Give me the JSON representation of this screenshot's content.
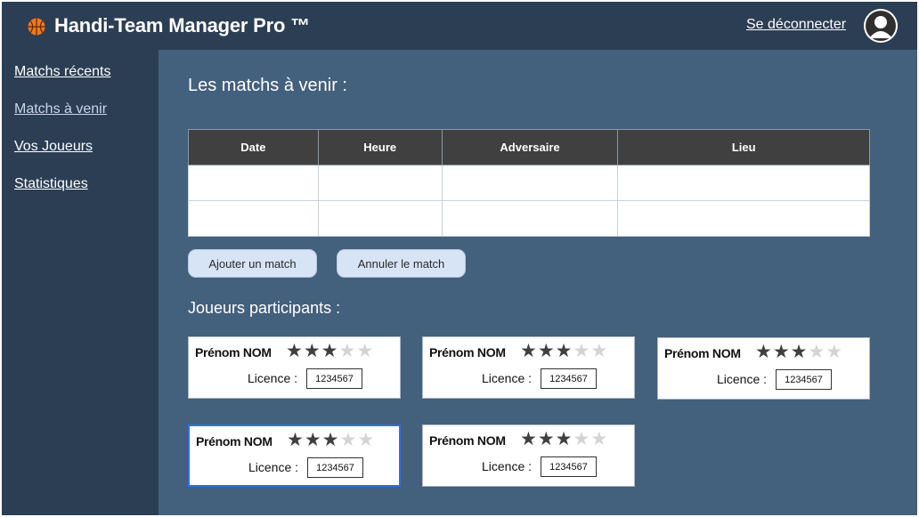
{
  "header": {
    "title": "Handi-Team Manager Pro ™",
    "logout": "Se déconnecter"
  },
  "sidebar": {
    "items": [
      {
        "label": "Matchs récents"
      },
      {
        "label": "Matchs à venir"
      },
      {
        "label": "Vos Joueurs"
      },
      {
        "label": "Statistiques"
      }
    ]
  },
  "main": {
    "upcoming_title": "Les matchs à venir :",
    "table": {
      "headers": [
        "Date",
        "Heure",
        "Adversaire",
        "Lieu"
      ]
    },
    "buttons": {
      "add": "Ajouter un match",
      "cancel": "Annuler le match"
    },
    "players_title": "Joueurs participants :",
    "players": [
      {
        "name": "Prénom NOM",
        "rating": 3,
        "max_rating": 5,
        "licence_label": "Licence :",
        "licence": "1234567"
      },
      {
        "name": "Prénom NOM",
        "rating": 3,
        "max_rating": 5,
        "licence_label": "Licence :",
        "licence": "1234567"
      },
      {
        "name": "Prénom NOM",
        "rating": 3,
        "max_rating": 5,
        "licence_label": "Licence :",
        "licence": "1234567"
      },
      {
        "name": "Prénom NOM",
        "rating": 3,
        "max_rating": 5,
        "licence_label": "Licence :",
        "licence": "1234567"
      },
      {
        "name": "Prénom NOM",
        "rating": 3,
        "max_rating": 5,
        "licence_label": "Licence :",
        "licence": "1234567"
      }
    ]
  },
  "icons": {
    "logo": "basketball-icon",
    "avatar": "user-avatar-icon",
    "star": "star-icon"
  },
  "colors": {
    "topbar": "#2c3e54",
    "main_bg": "#43607d",
    "table_header": "#404040",
    "button_bg": "#d7e4f6",
    "selected_border": "#2a72e8"
  }
}
